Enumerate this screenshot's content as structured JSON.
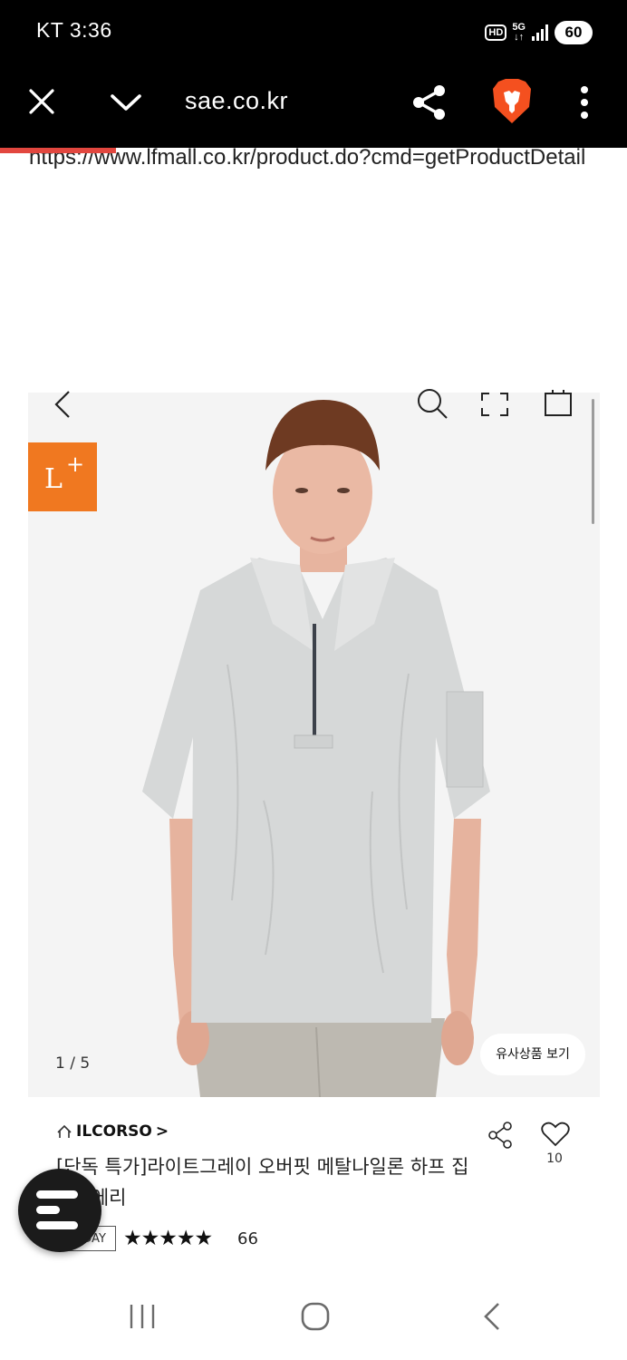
{
  "status_bar": {
    "carrier_time": "KT 3:36",
    "hd_label": "HD",
    "network_label": "5G",
    "battery": "60"
  },
  "browser": {
    "url_display": "sae.co.kr",
    "full_url": "https://www.lfmall.co.kr/product.do?cmd=getProductDetail",
    "progress_color": "#e2473f",
    "icons": [
      "close-icon",
      "chevron-down-icon",
      "share-icon",
      "brave-lion-icon",
      "more-vert-icon"
    ]
  },
  "product": {
    "badge_logo": "L+",
    "badge_color": "#f07820",
    "image_counter": "1 / 5",
    "similar_button": "유사상품 보기",
    "brand": "ILCORSO",
    "brand_chevron": ">",
    "title": "[단독 특가]라이트그레이 오버핏 메탈나일론 하프 집업 T에리",
    "like_count": "10",
    "badge_text": "TODAY",
    "stars": "★★★★★",
    "rating": 5,
    "review_count": "66"
  },
  "gallery_icons": [
    "back-chevron-icon",
    "search-icon",
    "fullscreen-icon",
    "shopping-bag-icon"
  ],
  "nav_icons": [
    "recent-apps-icon",
    "home-icon",
    "back-icon"
  ]
}
